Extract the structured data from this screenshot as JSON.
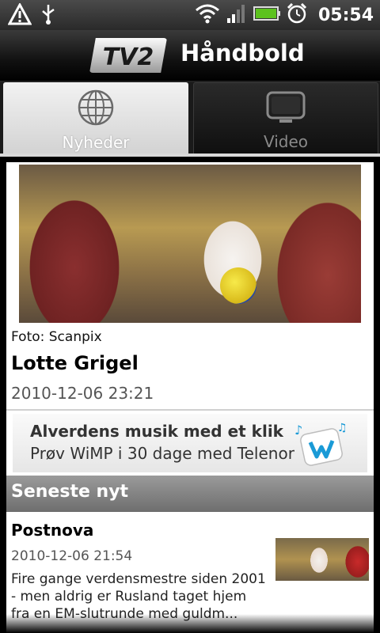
{
  "status_bar": {
    "time": "05:54",
    "icons": [
      "warning-icon",
      "usb-icon",
      "wifi-icon",
      "signal-icon",
      "battery-icon",
      "alarm-icon"
    ]
  },
  "app_bar": {
    "logo_text": "TV2",
    "title": "Håndbold"
  },
  "tabs": [
    {
      "label": "Nyheder",
      "icon": "globe-icon",
      "active": true
    },
    {
      "label": "Video",
      "icon": "tv-icon",
      "active": false
    }
  ],
  "top_story": {
    "caption": "Foto: Scanpix",
    "headline": "Lotte Grigel",
    "datetime": "2010-12-06 23:21"
  },
  "ad": {
    "line1": "Alverdens musik med et klik",
    "line2": "Prøv WiMP i 30 dage med Telenor"
  },
  "latest": {
    "section_title": "Seneste nyt",
    "items": [
      {
        "title": "Postnova",
        "datetime": "2010-12-06 21:54",
        "summary": "Fire gange verdensmestre siden 2001 - men aldrig er Rusland taget hjem fra en EM-slutrunde med guldm..."
      }
    ]
  },
  "colors": {
    "section_header": "#7e7e7e",
    "tab_active": "#e4e4e4",
    "ad_accent": "#1a9ad6"
  }
}
